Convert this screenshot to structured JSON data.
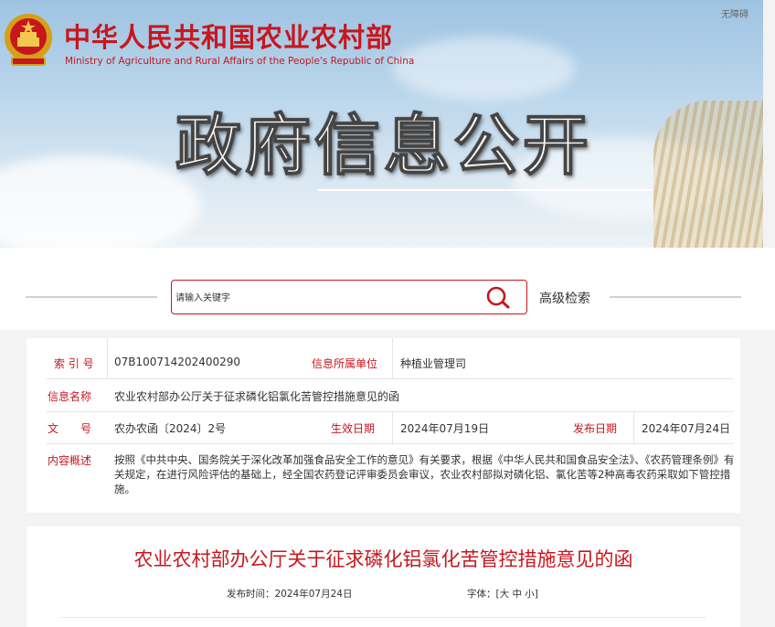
{
  "header": {
    "site_name_cn": "中华人民共和国农业农村部",
    "site_name_en": "Ministry of Agriculture and Rural Affairs of the People's Republic of China",
    "accessibility_label": "无障碍",
    "hero_title": "政府信息公开"
  },
  "search": {
    "placeholder": "请输入关键字",
    "advanced_label": "高级检索"
  },
  "metadata": {
    "index_label": "索 引 号",
    "index_value": "07B100714202400290",
    "unit_label": "信息所属单位",
    "unit_value": "种植业管理司",
    "name_label": "信息名称",
    "name_value": "农业农村部办公厅关于征求磷化铝氯化苦管控措施意见的函",
    "doc_label": "文　　号",
    "doc_value": "农办农函〔2024〕2号",
    "effective_label": "生效日期",
    "effective_value": "2024年07月19日",
    "publish_label": "发布日期",
    "publish_value": "2024年07月24日",
    "summary_label": "内容概述",
    "summary_value": "按照《中共中央、国务院关于深化改革加强食品安全工作的意见》有关要求，根据《中华人民共和国食品安全法》、《农药管理条例》有关规定，在进行风险评估的基础上，经全国农药登记评审委员会审议，农业农村部拟对磷化铝、氯化苦等2种高毒农药采取如下管控措施。"
  },
  "article": {
    "title": "农业农村部办公厅关于征求磷化铝氯化苦管控措施意见的函",
    "publish_time_label": "发布时间：",
    "publish_time_value": "2024年07月24日",
    "font_label": "字体：[",
    "font_large": "大",
    "font_medium": "中",
    "font_small": "小",
    "font_close": "]"
  },
  "colors": {
    "brand_red": "#c8161d",
    "text": "#333333",
    "background": "#f3f3f3"
  }
}
